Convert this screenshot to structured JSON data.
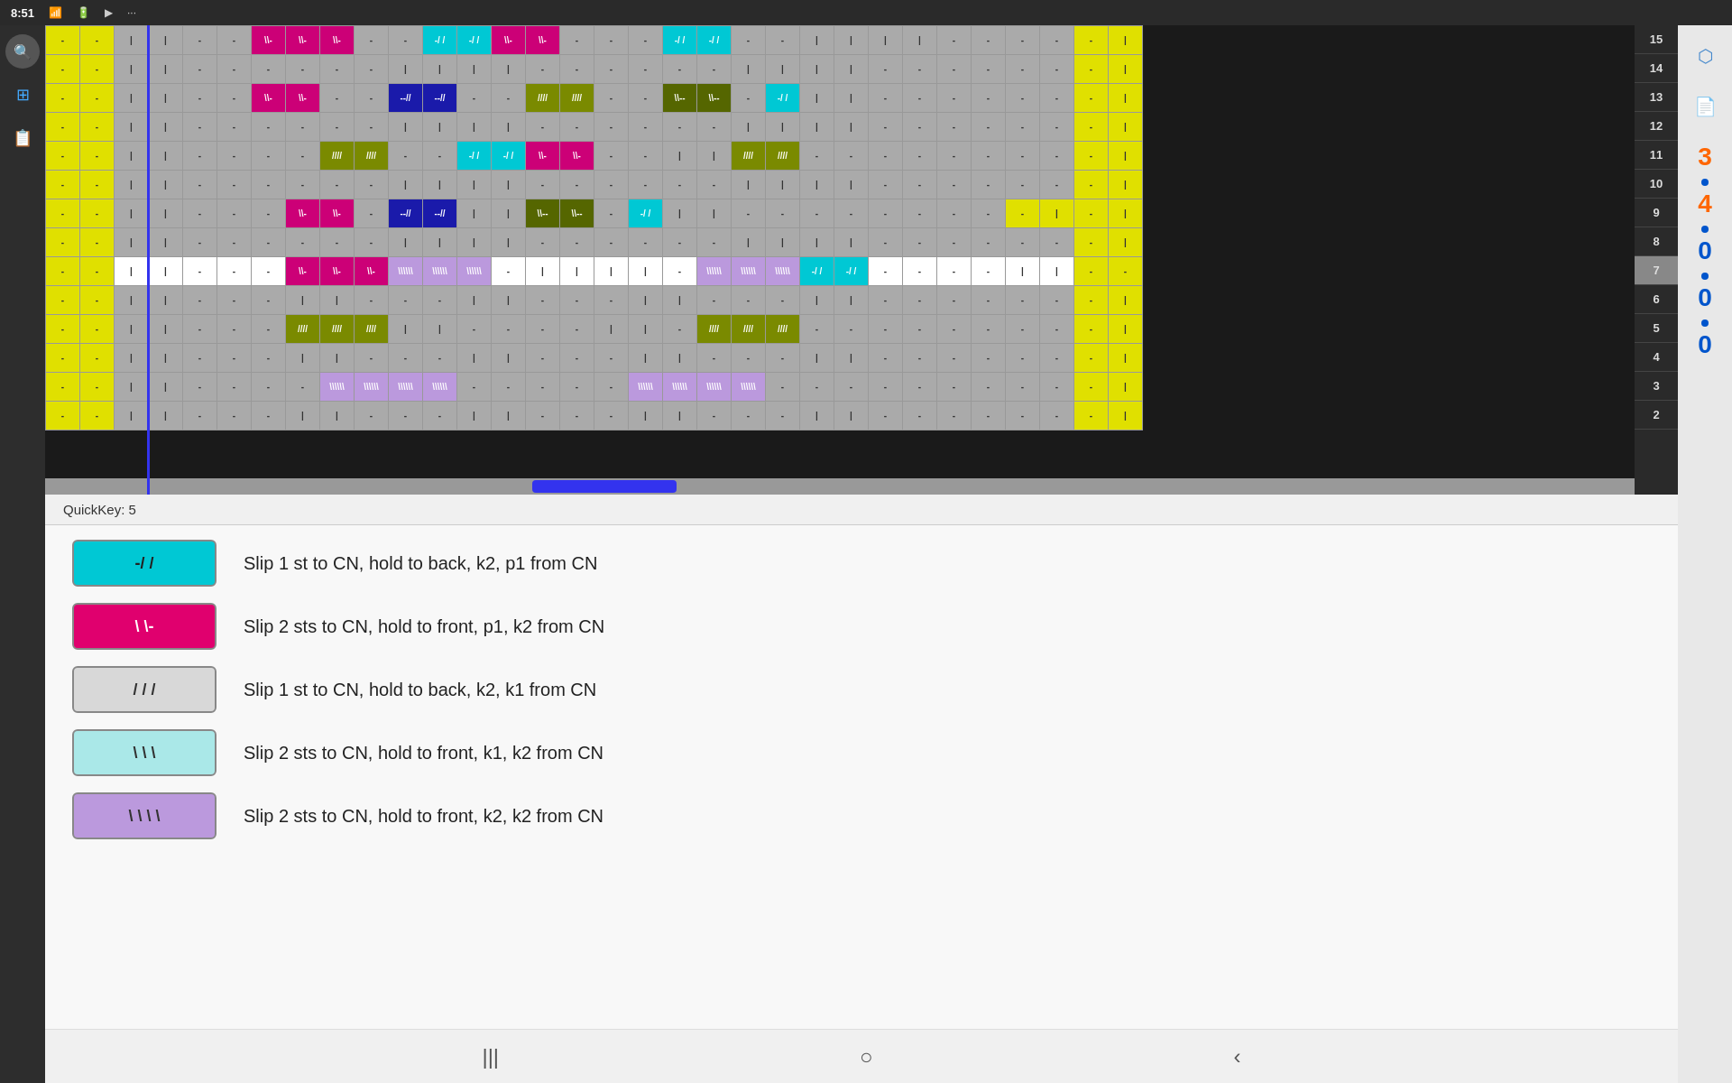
{
  "status_bar": {
    "time": "8:51",
    "icons": [
      "wifi",
      "battery"
    ]
  },
  "left_sidebar": {
    "icons": [
      "search",
      "grid-edit",
      "report"
    ]
  },
  "quickkey": {
    "label": "QuickKey: 5"
  },
  "legend": {
    "items": [
      {
        "swatch_bg": "#00c8d4",
        "swatch_text": "-/ /",
        "description": "Slip 1 st to CN, hold to back, k2, p1 from CN"
      },
      {
        "swatch_bg": "#e0006e",
        "swatch_text": "\\ \\-",
        "description": "Slip 2 sts to CN, hold to front, p1, k2 from CN"
      },
      {
        "swatch_bg": "#d8d8d8",
        "swatch_text": "/ / /",
        "description": "Slip 1 st to CN, hold to back, k2, k1 from CN"
      },
      {
        "swatch_bg": "#aae8e8",
        "swatch_text": "\\ \\ \\",
        "description": "Slip 2 sts to CN, hold to front, k1, k2 from CN"
      },
      {
        "swatch_bg": "#bb99dd",
        "swatch_text": "\\ \\ \\ \\",
        "description": "Slip 2 sts to CN, hold to front, k2, k2 from CN"
      }
    ]
  },
  "right_sidebar": {
    "numbers": [
      "3",
      "4",
      "0",
      "0",
      "0"
    ],
    "colors": [
      "orange",
      "orange",
      "blue",
      "blue",
      "blue"
    ]
  },
  "row_numbers": [
    15,
    14,
    13,
    12,
    11,
    10,
    9,
    8,
    7,
    6,
    5,
    4,
    3,
    2
  ],
  "bottom_nav": {
    "icons": [
      "|||",
      "○",
      "<"
    ]
  }
}
